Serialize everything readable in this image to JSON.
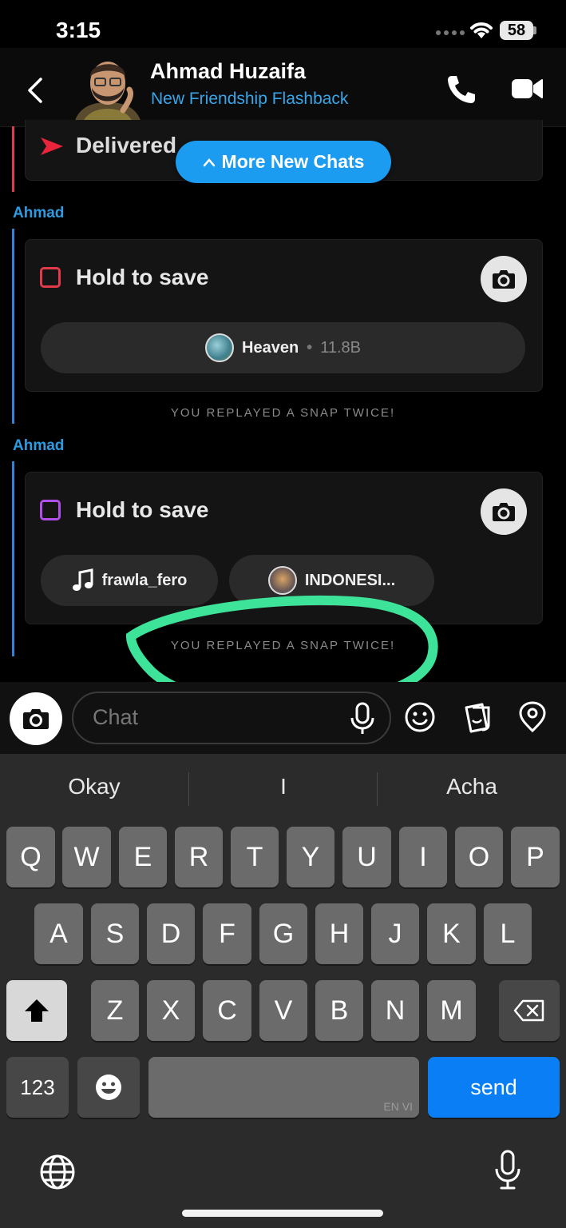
{
  "status_bar": {
    "time": "3:15",
    "battery": "58"
  },
  "header": {
    "contact_name": "Ahmad Huzaifa",
    "subtitle": "New Friendship Flashback",
    "icons": [
      "back-chevron-icon",
      "phone-icon",
      "video-camera-icon"
    ]
  },
  "feed": {
    "delivered_label": "Delivered",
    "more_chats_button": "More New Chats",
    "messages": [
      {
        "sender": "Ahmad",
        "label": "Hold to save",
        "box_color": "#e23a4b",
        "pills": [
          {
            "label": "Heaven",
            "meta": "11.8B"
          }
        ],
        "note": "YOU REPLAYED A SNAP TWICE!"
      },
      {
        "sender": "Ahmad",
        "label": "Hold to save",
        "box_color": "#b04ee8",
        "pills": [
          {
            "label": "frawla_fero",
            "icon": "music-note-icon"
          },
          {
            "label": "INDONESI..."
          }
        ],
        "note": "YOU REPLAYED A SNAP TWICE!"
      }
    ],
    "annotation_color": "#3ee39a"
  },
  "input": {
    "placeholder": "Chat",
    "icons": [
      "camera-icon",
      "microphone-icon",
      "emoji-icon",
      "sticker-icon",
      "location-icon"
    ]
  },
  "keyboard": {
    "suggestions": [
      "Okay",
      "I",
      "Acha"
    ],
    "row1": [
      "Q",
      "W",
      "E",
      "R",
      "T",
      "Y",
      "U",
      "I",
      "O",
      "P"
    ],
    "row2": [
      "A",
      "S",
      "D",
      "F",
      "G",
      "H",
      "J",
      "K",
      "L"
    ],
    "row3": [
      "Z",
      "X",
      "C",
      "V",
      "B",
      "N",
      "M"
    ],
    "numbers_key": "123",
    "send_key": "send",
    "space_language": "EN VI"
  },
  "colors": {
    "accent_blue": "#1b9cf0",
    "send_blue": "#0a7ff5"
  }
}
